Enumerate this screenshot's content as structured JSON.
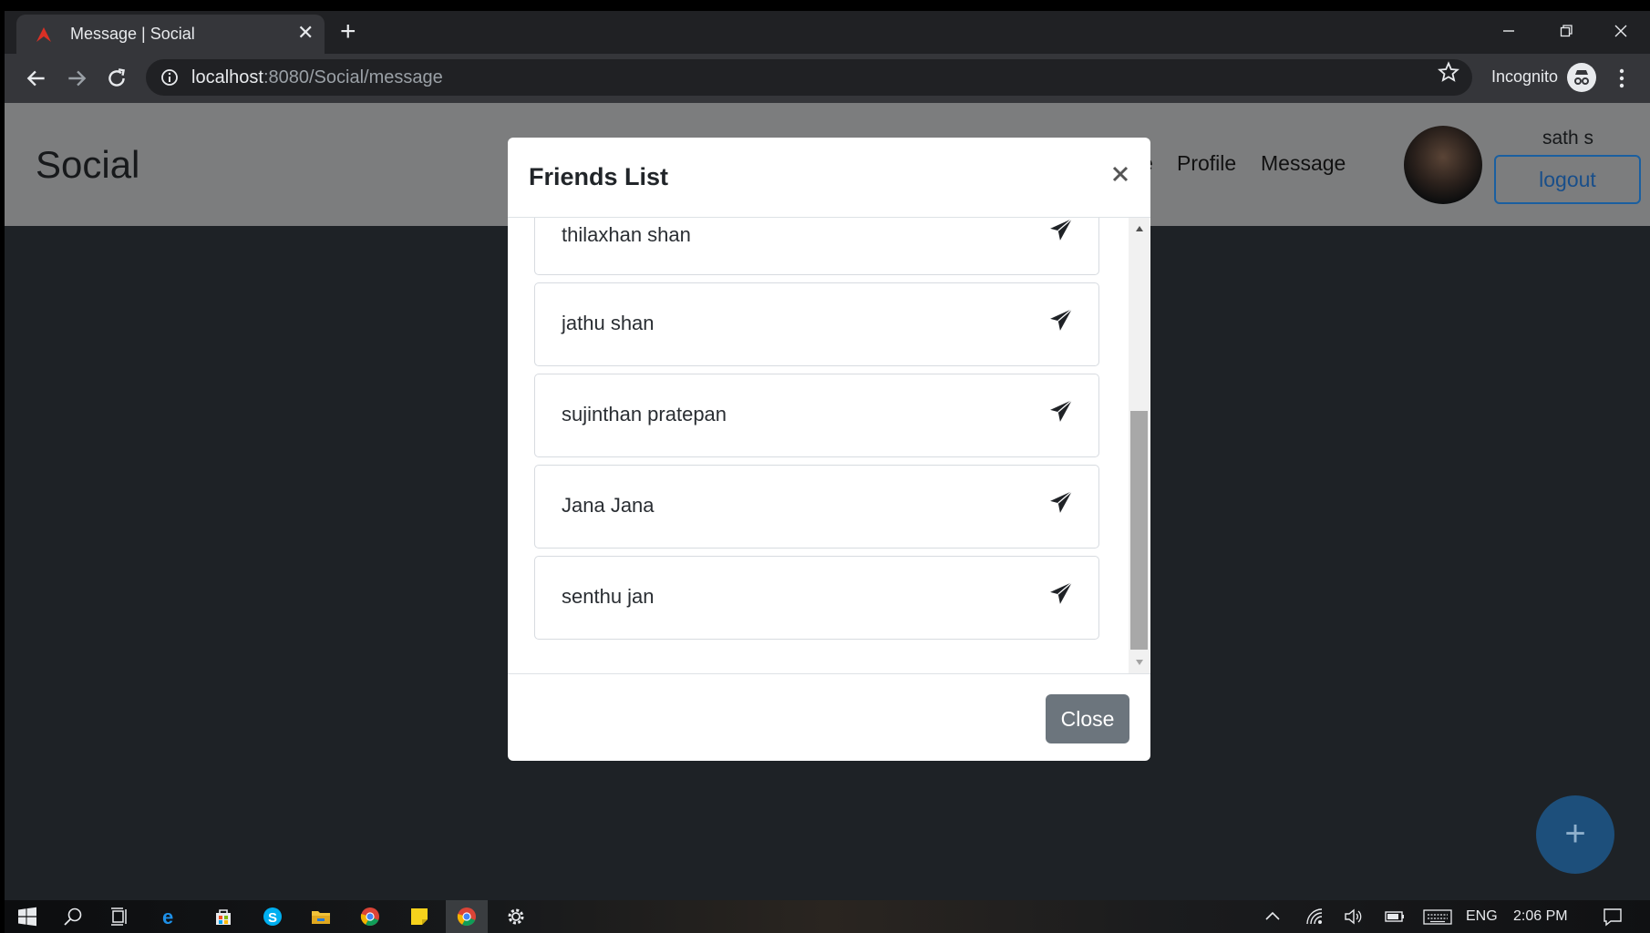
{
  "browser": {
    "tab_title": "Message | Social",
    "tab_close": "✕",
    "new_tab": "+",
    "url_host": "localhost",
    "url_path": ":8080/Social/message",
    "incognito_label": "Incognito"
  },
  "site": {
    "brand": "Social",
    "nav_partial": "e",
    "nav": [
      {
        "label": "Profile"
      },
      {
        "label": "Message"
      }
    ],
    "username": "sath s",
    "logout_label": "logout",
    "fab_label": "+"
  },
  "modal": {
    "title": "Friends List",
    "friends": [
      {
        "name": "thilaxhan shan"
      },
      {
        "name": "jathu shan"
      },
      {
        "name": "sujinthan pratepan"
      },
      {
        "name": "Jana Jana"
      },
      {
        "name": "senthu jan"
      }
    ],
    "close_label": "Close"
  },
  "taskbar": {
    "language": "ENG",
    "time": "2:06 PM"
  },
  "colors": {
    "navbar": "#7c7d7e",
    "overlay": "#1e2226",
    "primary": "#1a5fa0",
    "secondary": "#6c757d"
  }
}
